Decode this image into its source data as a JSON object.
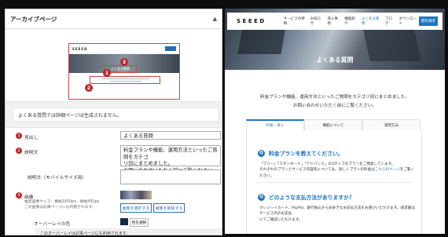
{
  "admin": {
    "panel_title": "アーカイブページ",
    "caret": "▲",
    "preview": {
      "logo": "SEEED",
      "hero_label": "よくある質問",
      "badges": [
        "1",
        "2",
        "3"
      ]
    },
    "notice": "よくある質問では詳細ページは生成されません。",
    "fields": {
      "heading": {
        "badge": "1",
        "label": "見出し",
        "value": "よくある質問"
      },
      "description": {
        "badge": "2",
        "label": "説明文",
        "value_line1": "料金プランや機能、運用方法といったご質問をカテゴ",
        "value_line2": "リ別にまとめました。",
        "value_line3": "お問い合わせいただく前にご覧ください。"
      },
      "mobile_description": {
        "label": "説明文（モバイルサイズ用）",
        "value": ""
      },
      "image": {
        "badge": "3",
        "label": "画像",
        "hint_line1": "推奨画像サイズ：横幅1450px、縦幅450px",
        "hint_line2": "この画像は記事ページにも利用されます。",
        "select_button": "画像を選択する",
        "delete_button": "画像を削除する"
      },
      "overlay": {
        "label": "オーバーレイの色",
        "color": "#132849",
        "color_button": "色を選択",
        "description": "このオーバーレイは記事ページにも利用されます。"
      }
    }
  },
  "site": {
    "logo": "SEEED",
    "menu": [
      "サービスの特徴",
      "お知らせ",
      "導入事例",
      "機能紹介",
      "よくある質問",
      "ブログ",
      "ダウンロード"
    ],
    "active_menu_index": 4,
    "cta": "資料請求",
    "hero_title": "よくある質問",
    "intro_line1": "料金プランや機能、運用方法といったご質問をカテゴリ別にまとめました。",
    "intro_line2": "お問い合わせいただく前にご覧ください。",
    "tabs": [
      "料金・導入",
      "機能について",
      "運用方法"
    ],
    "active_tab_index": 0,
    "faq": [
      {
        "icon": "Q",
        "question": "料金プランを教えてください。",
        "answer_line1": "「ブリー」「スタンダード」「アドバンス」の3タイプのプランをご用意しています。",
        "answer_line2_pre": "それぞれのプランとサービス内容等については、詳しくプランの料金は",
        "answer_line2_link": "こちらのページ",
        "answer_line2_post": "をご覧ください。"
      },
      {
        "icon": "Q",
        "question": "どのような支払方法がありますか？",
        "answer_line1": "クレジットカード、PayPal、銀行振込からお好きなお支払方法をお選びいただけます。請求書はサービス内のお支払",
        "answer_line2": "にてご確認いただけます。"
      }
    ],
    "colors": {
      "accent": "#1f74c4",
      "badge": "#c0272d"
    }
  }
}
